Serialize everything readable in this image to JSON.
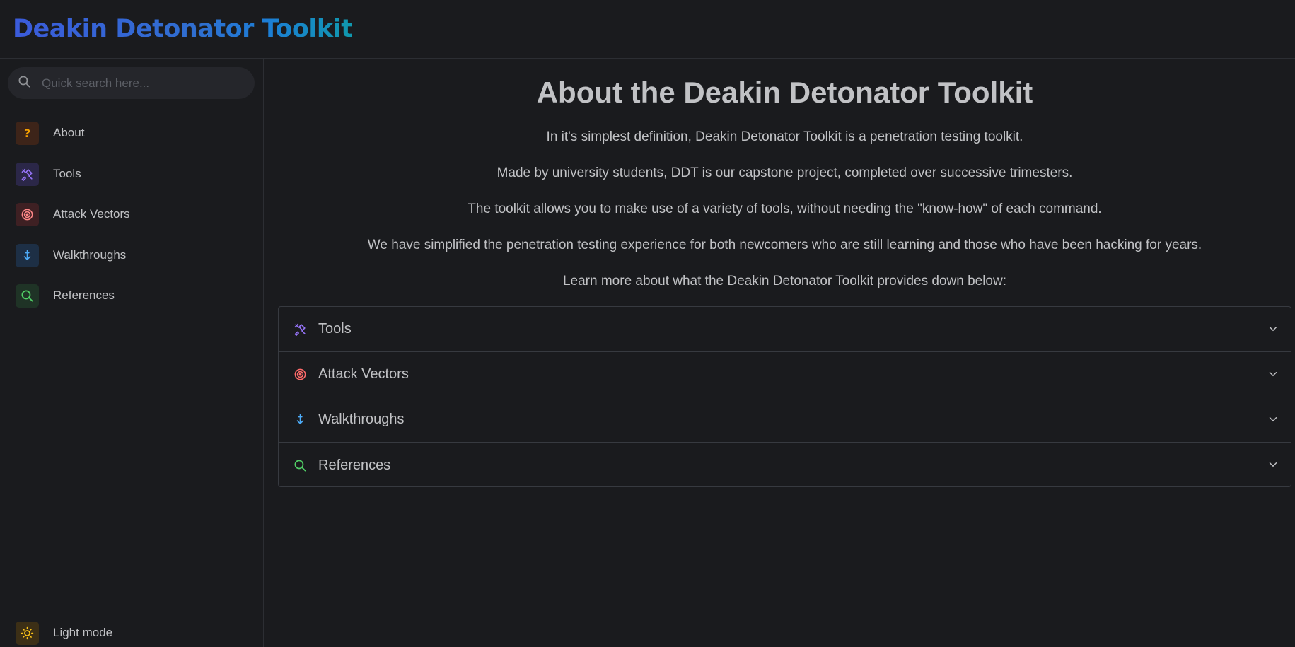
{
  "header": {
    "brand": "Deakin Detonator Toolkit"
  },
  "search": {
    "placeholder": "Quick search here..."
  },
  "sidebar": {
    "items": [
      {
        "label": "About",
        "icon": "question-mark-icon",
        "bg": "#3d2419",
        "fg": "#f59f00"
      },
      {
        "label": "Tools",
        "icon": "tools-icon",
        "bg": "#2b2748",
        "fg": "#9775fa"
      },
      {
        "label": "Attack Vectors",
        "icon": "target-icon",
        "bg": "#3e2023",
        "fg": "#ff8787"
      },
      {
        "label": "Walkthroughs",
        "icon": "arrow-down-icon",
        "bg": "#1d2f45",
        "fg": "#4dabf7"
      },
      {
        "label": "References",
        "icon": "search-icon",
        "bg": "#1f3326",
        "fg": "#51cf66"
      }
    ],
    "light_mode": {
      "label": "Light mode",
      "icon": "sun-icon",
      "bg": "#3c2f16",
      "fg": "#fcc419"
    }
  },
  "main": {
    "title": "About the Deakin Detonator Toolkit",
    "paragraphs": [
      "In it's simplest definition, Deakin Detonator Toolkit is a penetration testing toolkit.",
      "Made by university students, DDT is our capstone project, completed over successive trimesters.",
      "The toolkit allows you to make use of a variety of tools, without needing the \"know-how\" of each command.",
      "We have simplified the penetration testing experience for both newcomers who are still learning and those who have been hacking for years.",
      "Learn more about what the Deakin Detonator Toolkit provides down below:"
    ],
    "accordion": [
      {
        "label": "Tools",
        "icon": "tools-icon"
      },
      {
        "label": "Attack Vectors",
        "icon": "target-icon"
      },
      {
        "label": "Walkthroughs",
        "icon": "arrow-down-icon"
      },
      {
        "label": "References",
        "icon": "search-icon"
      }
    ]
  }
}
